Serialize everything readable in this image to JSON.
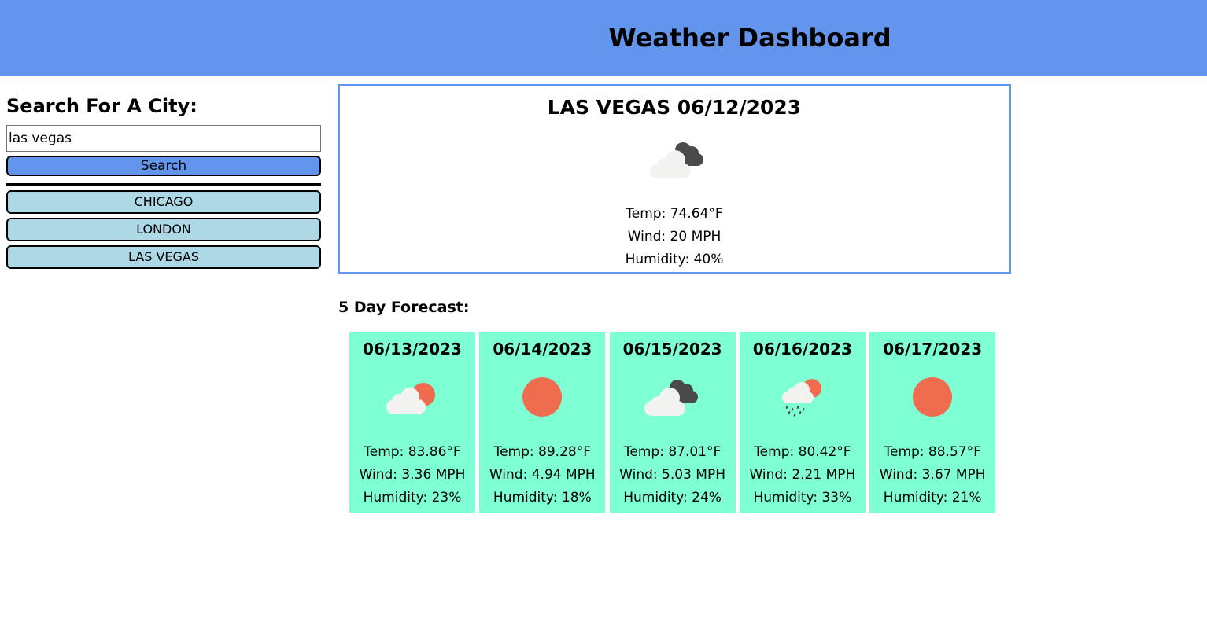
{
  "header": {
    "title": "Weather Dashboard"
  },
  "sidebar": {
    "heading": "Search For A City:",
    "search_value": "las vegas",
    "search_button": "Search",
    "history": [
      {
        "label": "CHICAGO"
      },
      {
        "label": "LONDON"
      },
      {
        "label": "LAS VEGAS"
      }
    ]
  },
  "current": {
    "title": "LAS VEGAS 06/12/2023",
    "icon": "broken-clouds-icon",
    "temp": "Temp: 74.64°F",
    "wind": "Wind: 20 MPH",
    "humidity": "Humidity: 40%"
  },
  "forecast": {
    "heading": "5 Day Forecast:",
    "days": [
      {
        "date": "06/13/2023",
        "icon": "few-clouds-icon",
        "temp": "Temp: 83.86°F",
        "wind": "Wind: 3.36 MPH",
        "humidity": "Humidity: 23%"
      },
      {
        "date": "06/14/2023",
        "icon": "clear-sky-icon",
        "temp": "Temp: 89.28°F",
        "wind": "Wind: 4.94 MPH",
        "humidity": "Humidity: 18%"
      },
      {
        "date": "06/15/2023",
        "icon": "broken-clouds-icon",
        "temp": "Temp: 87.01°F",
        "wind": "Wind: 5.03 MPH",
        "humidity": "Humidity: 24%"
      },
      {
        "date": "06/16/2023",
        "icon": "rain-icon",
        "temp": "Temp: 80.42°F",
        "wind": "Wind: 2.21 MPH",
        "humidity": "Humidity: 33%"
      },
      {
        "date": "06/17/2023",
        "icon": "clear-sky-icon",
        "temp": "Temp: 88.57°F",
        "wind": "Wind: 3.67 MPH",
        "humidity": "Humidity: 21%"
      }
    ]
  },
  "colors": {
    "header_bg": "#6495ed",
    "history_bg": "#add8e6",
    "card_bg": "#7fffd4",
    "sun": "#ef6c4e",
    "cloud_light": "#f2f2f0",
    "cloud_dark": "#4a4a4a"
  }
}
